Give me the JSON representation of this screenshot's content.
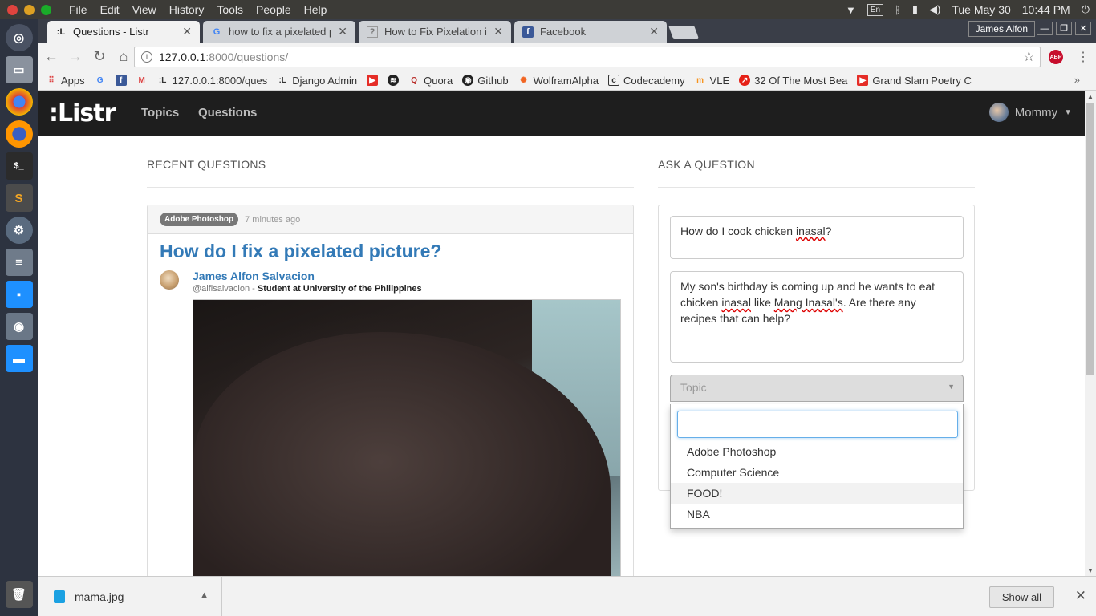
{
  "system": {
    "menus": [
      "File",
      "Edit",
      "View",
      "History",
      "Tools",
      "People",
      "Help"
    ],
    "lang": "En",
    "datetime": "Tue May 30",
    "clock": "10:44 PM"
  },
  "browser": {
    "tabs": [
      {
        "label": "Questions - Listr",
        "icon": "listr-icon"
      },
      {
        "label": "how to fix a pixelated pi",
        "icon": "google-icon"
      },
      {
        "label": "How to Fix Pixelation in",
        "icon": "question-icon"
      },
      {
        "label": "Facebook",
        "icon": "facebook-icon"
      }
    ],
    "profile_name": "James Alfon",
    "url_host": "127.0.0.1",
    "url_path": ":8000/questions/",
    "bookmarks": [
      "Apps",
      "",
      "",
      "",
      "127.0.0.1:8000/ques",
      "Django Admin",
      "",
      "",
      "Quora",
      "Github",
      "WolframAlpha",
      "Codecademy",
      "VLE",
      "32 Of The Most Bea",
      "Grand Slam Poetry C"
    ]
  },
  "app": {
    "logo": ":Listr",
    "nav": {
      "topics": "Topics",
      "questions": "Questions"
    },
    "user": "Mommy"
  },
  "recent": {
    "heading": "RECENT QUESTIONS",
    "question": {
      "topic": "Adobe Photoshop",
      "time": "7 minutes ago",
      "title": "How do I fix a pixelated picture?",
      "author": "James Alfon Salvacion",
      "handle": "@alfisalvacion",
      "sep": " - ",
      "bio": "Student at University of the Philippines"
    }
  },
  "ask": {
    "heading": "ASK A QUESTION",
    "title_pre": "How do I cook chicken ",
    "title_word": "inasal",
    "title_post": "?",
    "body_1": "My son's birthday is coming up and he wants to eat chicken ",
    "body_w1": "inasal",
    "body_2": " like ",
    "body_w2": "Mang Inasal's",
    "body_3": ". Are there any recipes that can help?",
    "topic_placeholder": "Topic",
    "topic_options": [
      "Adobe Photoshop",
      "Computer Science",
      "FOOD!",
      "NBA"
    ],
    "highlighted_option": "FOOD!"
  },
  "downloads": {
    "file": "mama.jpg",
    "show_all": "Show all"
  }
}
